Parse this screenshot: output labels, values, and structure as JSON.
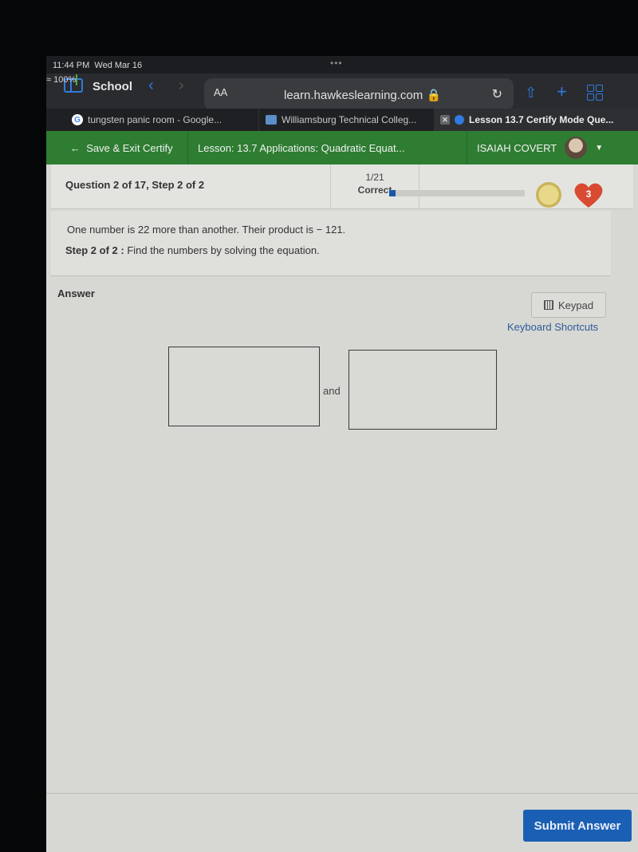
{
  "status_bar": {
    "time": "11:44 PM",
    "date": "Wed Mar 16",
    "battery": "100%"
  },
  "browser": {
    "tab_group": "School",
    "text_size_label": "AA",
    "url": "learn.hawkeslearning.com",
    "tabs": [
      {
        "label": "tungsten panic room - Google...",
        "icon": "google-icon",
        "active": false
      },
      {
        "label": "Williamsburg Technical Colleg...",
        "icon": "college-icon",
        "active": false
      },
      {
        "label": "Lesson 13.7 Certify Mode Que...",
        "icon": "hawkes-icon",
        "active": true
      }
    ]
  },
  "app_header": {
    "save_exit": "Save & Exit Certify",
    "lesson": "Lesson: 13.7 Applications: Quadratic Equat...",
    "user_name": "ISAIAH COVERT"
  },
  "question_bar": {
    "title": "Question 2 of 17, Step 2 of 2",
    "score": "1/21",
    "score_label": "Correct",
    "progress_fraction": 0.048,
    "lives": "3"
  },
  "problem": {
    "statement": "One number is 22 more than another. Their product is − 121.",
    "step_label": "Step 2 of 2 :",
    "step_text": "Find the numbers by solving the equation."
  },
  "answer": {
    "label": "Answer",
    "keypad_label": "Keypad",
    "shortcuts_label": "Keyboard Shortcuts",
    "first_value": "",
    "second_value": "",
    "joiner": "and"
  },
  "footer": {
    "submit_label": "Submit Answer"
  },
  "colors": {
    "header_green": "#2e7d32",
    "submit_blue": "#1a5fb4",
    "heart_red": "#d84a32",
    "link_blue": "#2d5b9a"
  }
}
